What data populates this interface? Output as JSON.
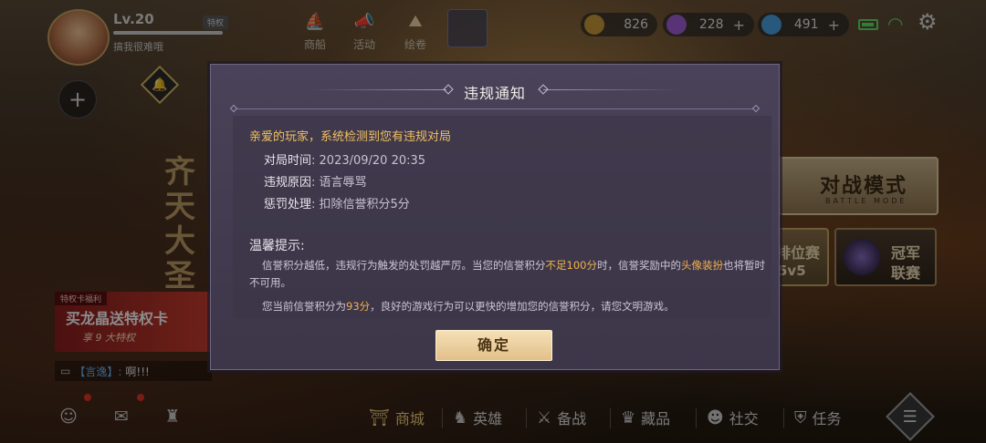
{
  "player": {
    "level": "Lv.20",
    "badge": "特权",
    "name": "搞我很难哦"
  },
  "topnav": [
    {
      "label": "商船",
      "icon": "ship-icon"
    },
    {
      "label": "活动",
      "icon": "megaphone-icon"
    },
    {
      "label": "绘卷",
      "icon": "scroll-icon"
    }
  ],
  "currencies": [
    {
      "value": "826",
      "icon": "coin-icon",
      "color": "#c89a3a"
    },
    {
      "value": "228",
      "icon": "purple-gem-icon",
      "color": "#a060d8"
    },
    {
      "value": "491",
      "icon": "blue-crystal-icon",
      "color": "#4aa0e0"
    }
  ],
  "background": {
    "calligraphy": "齐天大圣"
  },
  "modes": {
    "battle_title": "对战模式",
    "battle_sub": "BATTLE MODE",
    "ranked_1": "排位赛",
    "ranked_2": "5v5",
    "champion_1": "冠军",
    "champion_2": "联赛"
  },
  "promo": {
    "tag": "特权卡福利",
    "main": "买龙晶送特权卡",
    "sub": "享 9 大特权"
  },
  "chat": {
    "channel": "【言逸】:",
    "message": "啊!!!"
  },
  "bottom_nav": [
    {
      "label": "商城",
      "icon": "shop-icon"
    },
    {
      "label": "英雄",
      "icon": "hero-icon"
    },
    {
      "label": "备战",
      "icon": "prepare-icon"
    },
    {
      "label": "藏品",
      "icon": "collection-icon"
    },
    {
      "label": "社交",
      "icon": "social-icon"
    },
    {
      "label": "任务",
      "icon": "task-icon"
    }
  ],
  "modal": {
    "title": "违规通知",
    "greeting": "亲爱的玩家，系统检测到您有违规对局",
    "rows": [
      {
        "key": "对局时间",
        "value": ": 2023/09/20 20:35"
      },
      {
        "key": "违规原因",
        "value": ": 语言辱骂"
      },
      {
        "key": "惩罚处理",
        "value": ": 扣除信誉积分5分"
      }
    ],
    "tips_title": "温馨提示:",
    "tip1_a": "信誉积分越低，违规行为触发的处罚越严厉。当您的信誉积分",
    "tip1_hl": "不足100分",
    "tip1_b": "时，信誉奖励中的",
    "tip1_hl2": "头像装扮",
    "tip1_c": "也将暂时不可用。",
    "tip2_a": "您当前信誉积分为",
    "tip2_hl": "93分",
    "tip2_b": "，良好的游戏行为可以更快的增加您的信誉积分，请您文明游戏。",
    "confirm": "确定"
  }
}
